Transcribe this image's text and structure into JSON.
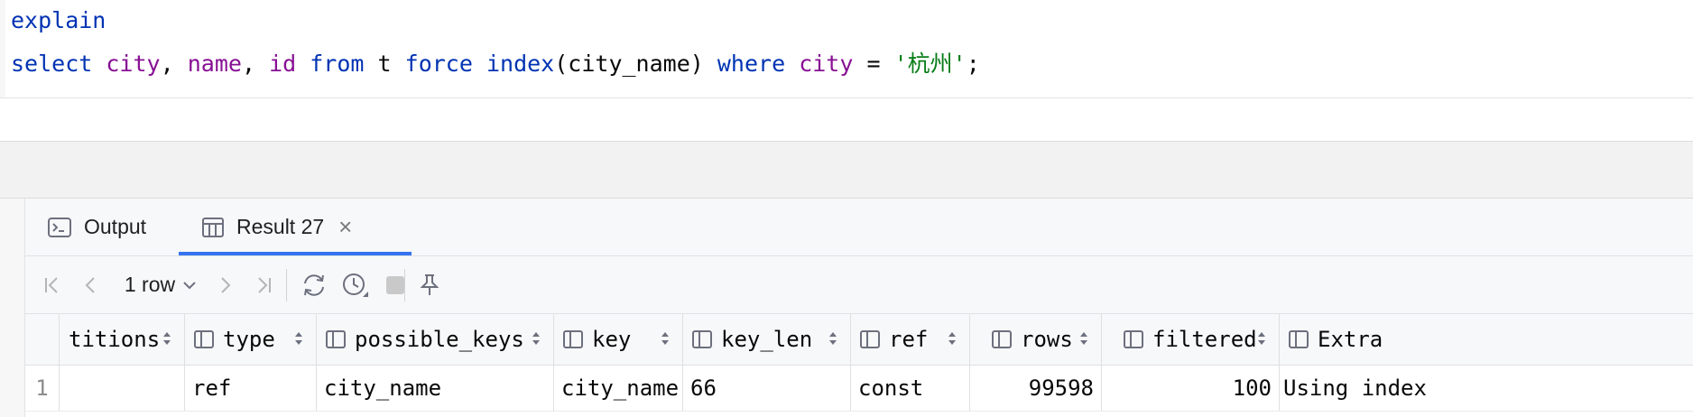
{
  "editor": {
    "line1": {
      "kw": "explain"
    },
    "line2": {
      "select": "select",
      "col1": "city",
      "comma1": ",",
      "col2": "name",
      "comma2": ",",
      "col3": "id",
      "from": "from",
      "table": "t",
      "force": "force",
      "index_kw": "index",
      "index_arg": "(city_name)",
      "where": "where",
      "cond_col": "city",
      "eq": "=",
      "literal": "'杭州'",
      "semicolon": ";"
    }
  },
  "tabs": [
    {
      "label": "Output",
      "icon": "console-icon"
    },
    {
      "label": "Result 27",
      "icon": "table-icon",
      "closable": true,
      "active": true
    }
  ],
  "toolbar": {
    "row_selector": "1 row",
    "icons": [
      "first-page-icon",
      "prev-page-icon",
      "next-page-icon",
      "last-page-icon",
      "refresh-icon",
      "history-icon",
      "stop-icon",
      "pin-icon"
    ]
  },
  "grid": {
    "columns": [
      "titions",
      "type",
      "possible_keys",
      "key",
      "key_len",
      "ref",
      "rows",
      "filtered",
      "Extra"
    ],
    "rows": [
      {
        "num": "1",
        "cells": [
          "",
          "ref",
          "city_name",
          "city_name",
          "66",
          "const",
          "99598",
          "100",
          "Using index"
        ]
      }
    ]
  },
  "colors": {
    "keyword": "#0033b3",
    "identifier": "#871094",
    "string": "#067d17",
    "active_tab_underline": "#3574f0"
  }
}
